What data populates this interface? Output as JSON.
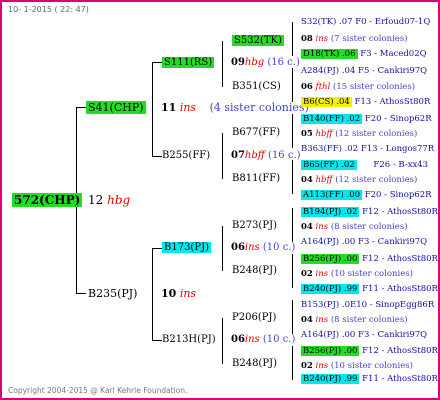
{
  "header": "10-  1-2015 ( 22: 47)",
  "footer": "Copyright 2004-2015 @ Karl Kehrle Foundation.",
  "root": {
    "id": "572(CHP)",
    "num": "12",
    "name": "hbg"
  },
  "g1": {
    "sire": {
      "id": "S41(CHP)",
      "num": "11",
      "name": "ins",
      "note": "(4 sister colonies)"
    },
    "dam": {
      "id": "B235(PJ)",
      "num": "10",
      "name": "ins"
    }
  },
  "g2": {
    "s_s": {
      "id": "S111(RS)",
      "num": "09",
      "name": "hbg",
      "note": "(16 c.)"
    },
    "s_d": {
      "id": "B255(FF)",
      "num": "07",
      "name": "hbff",
      "note": "(16 c.)"
    },
    "d_s": {
      "id": "B173(PJ)",
      "num": "06",
      "name": "ins",
      "note": "(10 c.)"
    },
    "d_d": {
      "id": "B213H(PJ)",
      "num": "06",
      "name": "ins",
      "note": "(10 c.)"
    }
  },
  "g3": {
    "a": "S532(TK)",
    "b": "B351(CS)",
    "c": "B677(FF)",
    "d": "B811(FF)",
    "e": "B273(PJ)",
    "f": "B248(PJ)",
    "g": "P206(PJ)",
    "h": "B248(PJ)"
  },
  "g4": [
    {
      "top": "S32(TK) .07 F0 - Erfoud07-1Q",
      "mid_num": "08",
      "mid_name": "ins",
      "mid_note": "(7 sister colonies)",
      "bot": "D18(TK) .06",
      "bot_tail": "F3 - Maced02Q"
    },
    {
      "top": "A284(PJ) .04  F5 - Cankiri97Q",
      "mid_num": "06",
      "mid_name": "fthl",
      "mid_note": "(15 sister colonies)",
      "bot": "B6(CS) .04",
      "bot_tail": "F13 - AthosSt80R"
    },
    {
      "top": "B140(FF) .02",
      "top_tail": "F20 - Sinop62R",
      "mid_num": "05",
      "mid_name": "hbff",
      "mid_note": "(12 sister colonies)",
      "bot": "B363(FF) .02 F13 - Longos77R"
    },
    {
      "top": "B65(FF) .02",
      "top_tail": "F26 - B-xx43",
      "mid_num": "04",
      "mid_name": "hbff",
      "mid_note": "(12 sister colonies)",
      "bot": "A113(FF) .00",
      "bot_tail": "F20 - Sinop62R"
    },
    {
      "top": "B194(PJ) .02",
      "top_tail": "F12 - AthosSt80R",
      "mid_num": "04",
      "mid_name": "ins",
      "mid_note": "(8 sister colonies)",
      "bot": "A164(PJ) .00   F3 - Cankiri97Q"
    },
    {
      "top": "B256(PJ) .00",
      "top_tail": "F12 - AthosSt80R",
      "mid_num": "02",
      "mid_name": "ins",
      "mid_note": "(10 sister colonies)",
      "bot": "B240(PJ) .99",
      "bot_tail": "F11 - AthosSt80R"
    },
    {
      "top": "B153(PJ) .0E10 - SinopEgg86R",
      "mid_num": "04",
      "mid_name": "ins",
      "mid_note": "(8 sister colonies)",
      "bot": "A164(PJ) .00   F3 - Cankiri97Q"
    },
    {
      "top": "B256(PJ) .00",
      "top_tail": "F12 - AthosSt80R",
      "mid_num": "02",
      "mid_name": "ins",
      "mid_note": "(10 sister colonies)",
      "bot": "B240(PJ) .99",
      "bot_tail": "F11 - AthosSt80R"
    }
  ]
}
